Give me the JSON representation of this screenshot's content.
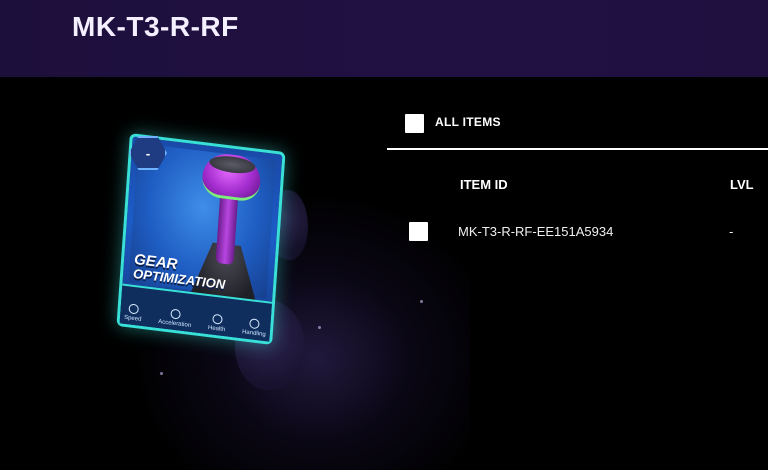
{
  "header": {
    "title": "MK-T3-R-RF"
  },
  "item_card": {
    "level_badge": "-",
    "name_line1": "GEAR",
    "name_line2": "OPTIMIZATION",
    "stats": [
      "Speed",
      "Acceleration",
      "Health",
      "Handling"
    ],
    "accent_color": "#39e0d8"
  },
  "list": {
    "select_all_label": "ALL ITEMS",
    "columns": {
      "item_id": "ITEM ID",
      "level": "LVL"
    },
    "rows": [
      {
        "item_id": "MK-T3-R-RF-EE151A5934",
        "level": "-"
      }
    ]
  }
}
